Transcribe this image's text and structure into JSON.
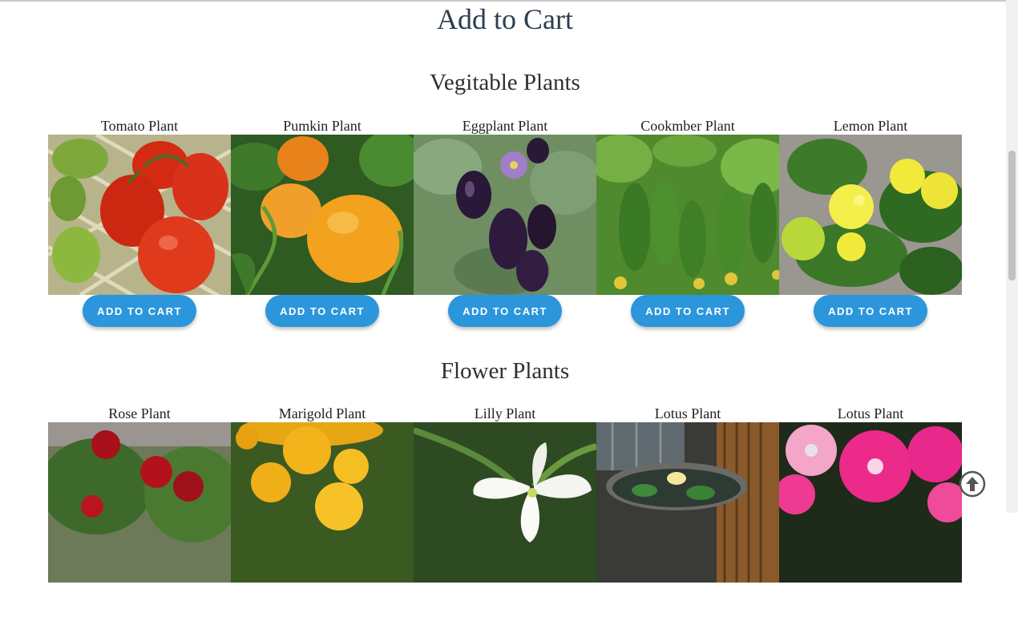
{
  "page": {
    "title": "Add to Cart"
  },
  "sections": [
    {
      "title": "Vegitable Plants",
      "items": [
        {
          "name": "Tomato Plant",
          "button": "ADD TO CART",
          "image": "tomato"
        },
        {
          "name": "Pumkin Plant",
          "button": "ADD TO CART",
          "image": "pumpkin"
        },
        {
          "name": "Eggplant Plant",
          "button": "ADD TO CART",
          "image": "eggplant"
        },
        {
          "name": "Cookmber Plant",
          "button": "ADD TO CART",
          "image": "cucumber"
        },
        {
          "name": "Lemon Plant",
          "button": "ADD TO CART",
          "image": "lemon"
        }
      ]
    },
    {
      "title": "Flower Plants",
      "items": [
        {
          "name": "Rose Plant",
          "image": "rose"
        },
        {
          "name": "Marigold Plant",
          "image": "marigold"
        },
        {
          "name": "Lilly Plant",
          "image": "lily"
        },
        {
          "name": "Lotus Plant",
          "image": "lotus"
        },
        {
          "name": "Lotus Plant",
          "image": "petunia"
        }
      ]
    }
  ],
  "colors": {
    "button": "#2b96dc",
    "title": "#2c3e50",
    "background": "#ffffff"
  },
  "icons": {
    "scroll_top": "arrow-up-circle-icon"
  }
}
